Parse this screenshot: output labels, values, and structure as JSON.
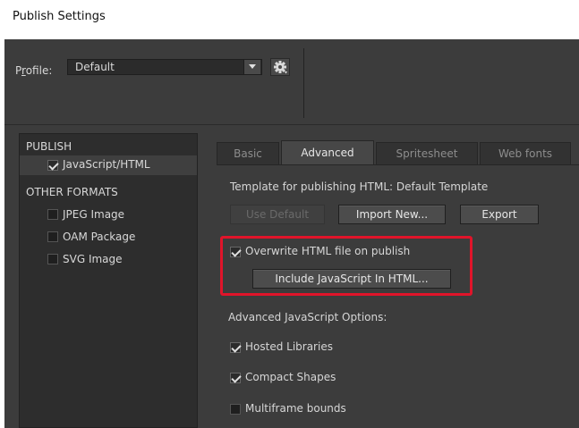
{
  "window": {
    "title": "Publish Settings"
  },
  "profile": {
    "label": "Profile:",
    "value": "Default"
  },
  "left_panel": {
    "section_publish": "PUBLISH",
    "javascript_html": {
      "label": "JavaScript/HTML",
      "checked": true
    },
    "section_other": "OTHER FORMATS",
    "jpeg": {
      "label": "JPEG Image",
      "checked": false
    },
    "oam": {
      "label": "OAM Package",
      "checked": false
    },
    "svg": {
      "label": "SVG Image",
      "checked": false
    }
  },
  "tabs": [
    {
      "label": "Basic",
      "active": false
    },
    {
      "label": "Advanced",
      "active": true
    },
    {
      "label": "Spritesheet",
      "active": false
    },
    {
      "label": "Web fonts",
      "active": false
    }
  ],
  "advanced": {
    "template_text": "Template for publishing HTML: Default Template",
    "use_default": "Use Default",
    "import_new": "Import New...",
    "export": "Export",
    "overwrite": {
      "label": "Overwrite HTML file on publish",
      "checked": true
    },
    "include_js": "Include JavaScript In HTML...",
    "options_title": "Advanced JavaScript Options:",
    "hosted_libraries": {
      "label": "Hosted Libraries",
      "checked": true
    },
    "compact_shapes": {
      "label": "Compact Shapes",
      "checked": true
    },
    "multiframe_bounds": {
      "label": "Multiframe bounds",
      "checked": false
    }
  },
  "colors": {
    "background": "#3c3c3c",
    "highlight": "#e0142a"
  }
}
